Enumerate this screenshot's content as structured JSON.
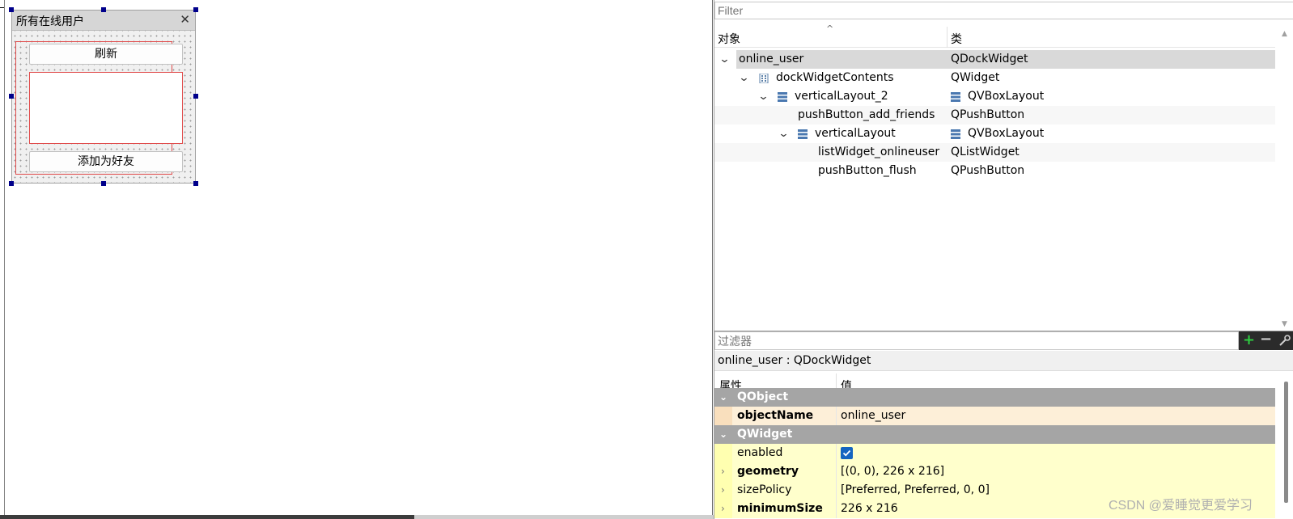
{
  "designer": {
    "dock_title": "所有在线用户",
    "close_glyph": "✕",
    "refresh_button": "刷新",
    "add_friend_button": "添加为好友"
  },
  "object_inspector": {
    "filter_placeholder": "Filter",
    "col_object": "对象",
    "col_class": "类",
    "rows": [
      {
        "name": "online_user",
        "class": "QDockWidget"
      },
      {
        "name": "dockWidgetContents",
        "class": "QWidget"
      },
      {
        "name": "verticalLayout_2",
        "class": "QVBoxLayout"
      },
      {
        "name": "pushButton_add_friends",
        "class": "QPushButton"
      },
      {
        "name": "verticalLayout",
        "class": "QVBoxLayout"
      },
      {
        "name": "listWidget_onlineuser",
        "class": "QListWidget"
      },
      {
        "name": "pushButton_flush",
        "class": "QPushButton"
      }
    ]
  },
  "property_editor": {
    "filter_placeholder": "过滤器",
    "object_label": "online_user : QDockWidget",
    "col_property": "属性",
    "col_value": "值",
    "groups": [
      {
        "name": "QObject"
      },
      {
        "name": "QWidget"
      }
    ],
    "props": [
      {
        "name": "objectName",
        "value": "online_user"
      },
      {
        "name": "enabled",
        "value": ""
      },
      {
        "name": "geometry",
        "value": "[(0, 0), 226 x 216]"
      },
      {
        "name": "sizePolicy",
        "value": "[Preferred, Preferred, 0, 0]"
      },
      {
        "name": "minimumSize",
        "value": "226 x 216"
      }
    ]
  },
  "watermark": "CSDN @爱睡觉更爱学习",
  "colors": {
    "selection_gray": "#d9d9d9",
    "group_header": "#a5a5a5",
    "object_row_peach": "#fdefd8",
    "property_row_yellow": "#ffffcc",
    "layout_outline_red": "#e04c4c",
    "checkbox_blue": "#1565c0",
    "handle_navy": "#00008b"
  }
}
